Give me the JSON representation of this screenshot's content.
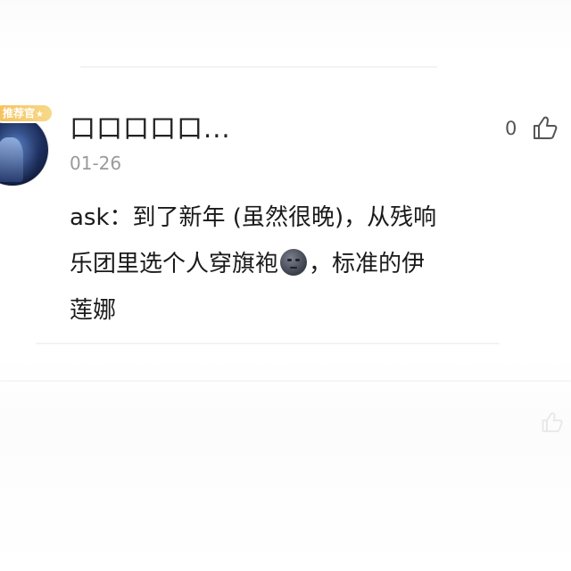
{
  "comment": {
    "avatar_badge": "推荐官",
    "username": "口口口口口...",
    "date": "01-26",
    "like_count": "0",
    "content_line1": "ask：到了新年 (虽然很晚)，从残响",
    "content_line2_a": "乐团里选个人穿旗袍",
    "content_line2_b": "，标准的伊",
    "content_line3": "莲娜",
    "emoji": "new-moon-face-emoji"
  },
  "icons": {
    "like": "thumbs-up-icon",
    "ghost_like": "thumbs-up-icon"
  }
}
